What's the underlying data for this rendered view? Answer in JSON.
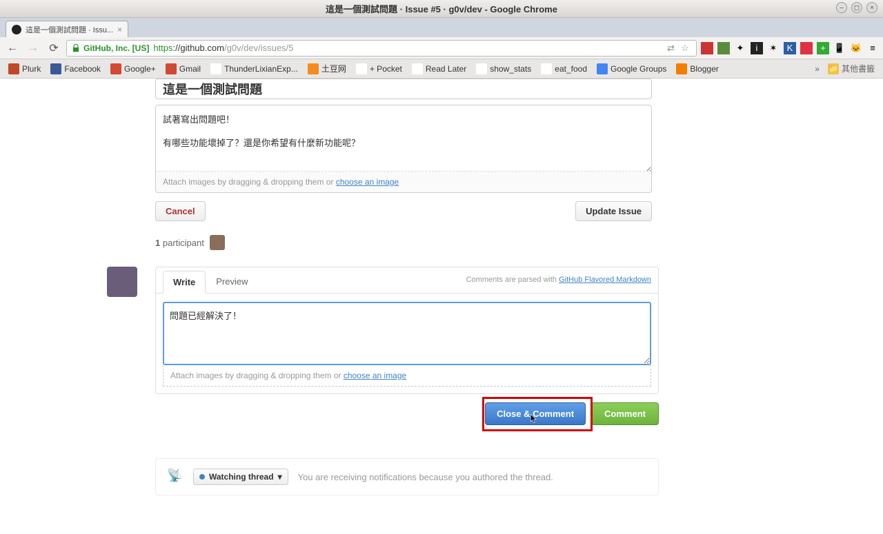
{
  "window": {
    "title": "這是一個測試問題 · Issue #5 · g0v/dev - Google Chrome"
  },
  "tab": {
    "label": "這是一個測試問題 · Issu..."
  },
  "nav": {
    "back": "←",
    "forward": "→",
    "reload": "⟳"
  },
  "url": {
    "ev": "GitHub, Inc. [US]",
    "scheme": "https",
    "host": "://github.com",
    "path": "/g0v/dev/issues/5"
  },
  "bookmarks": [
    {
      "label": "Plurk",
      "color": "#c1482d"
    },
    {
      "label": "Facebook",
      "color": "#3b5998"
    },
    {
      "label": "Google+",
      "color": "#d34836"
    },
    {
      "label": "Gmail",
      "color": "#d14836"
    },
    {
      "label": "ThunderLixianExp...",
      "color": "#fff"
    },
    {
      "label": "土豆网",
      "color": "#f68b1f"
    },
    {
      "label": "+ Pocket",
      "color": "#fff"
    },
    {
      "label": "Read Later",
      "color": "#fff"
    },
    {
      "label": "show_stats",
      "color": "#fff"
    },
    {
      "label": "eat_food",
      "color": "#fff"
    },
    {
      "label": "Google Groups",
      "color": "#4285f4"
    },
    {
      "label": "Blogger",
      "color": "#f57d00"
    }
  ],
  "bookmark_overflow": "»",
  "bookmark_folder": "其他書籤",
  "issue": {
    "title_value": "這是一個測試問題",
    "body_value": "試著寫出問題吧！\n\n有哪些功能壞掉了？還是你希望有什麼新功能呢？",
    "attach_text": "Attach images by dragging & dropping them or ",
    "attach_link": "choose an image",
    "cancel": "Cancel",
    "update": "Update Issue"
  },
  "participants": {
    "count": "1",
    "label": "participant"
  },
  "comment": {
    "tab_write": "Write",
    "tab_preview": "Preview",
    "hint_pre": "Comments are parsed with ",
    "hint_link": "GitHub Flavored Markdown",
    "value": "問題已經解決了！",
    "attach_text": "Attach images by dragging & dropping them or ",
    "attach_link": "choose an image",
    "close_comment": "Close & Comment",
    "comment": "Comment"
  },
  "watch": {
    "button": "Watching thread",
    "reason": "You are receiving notifications because you authored the thread."
  }
}
